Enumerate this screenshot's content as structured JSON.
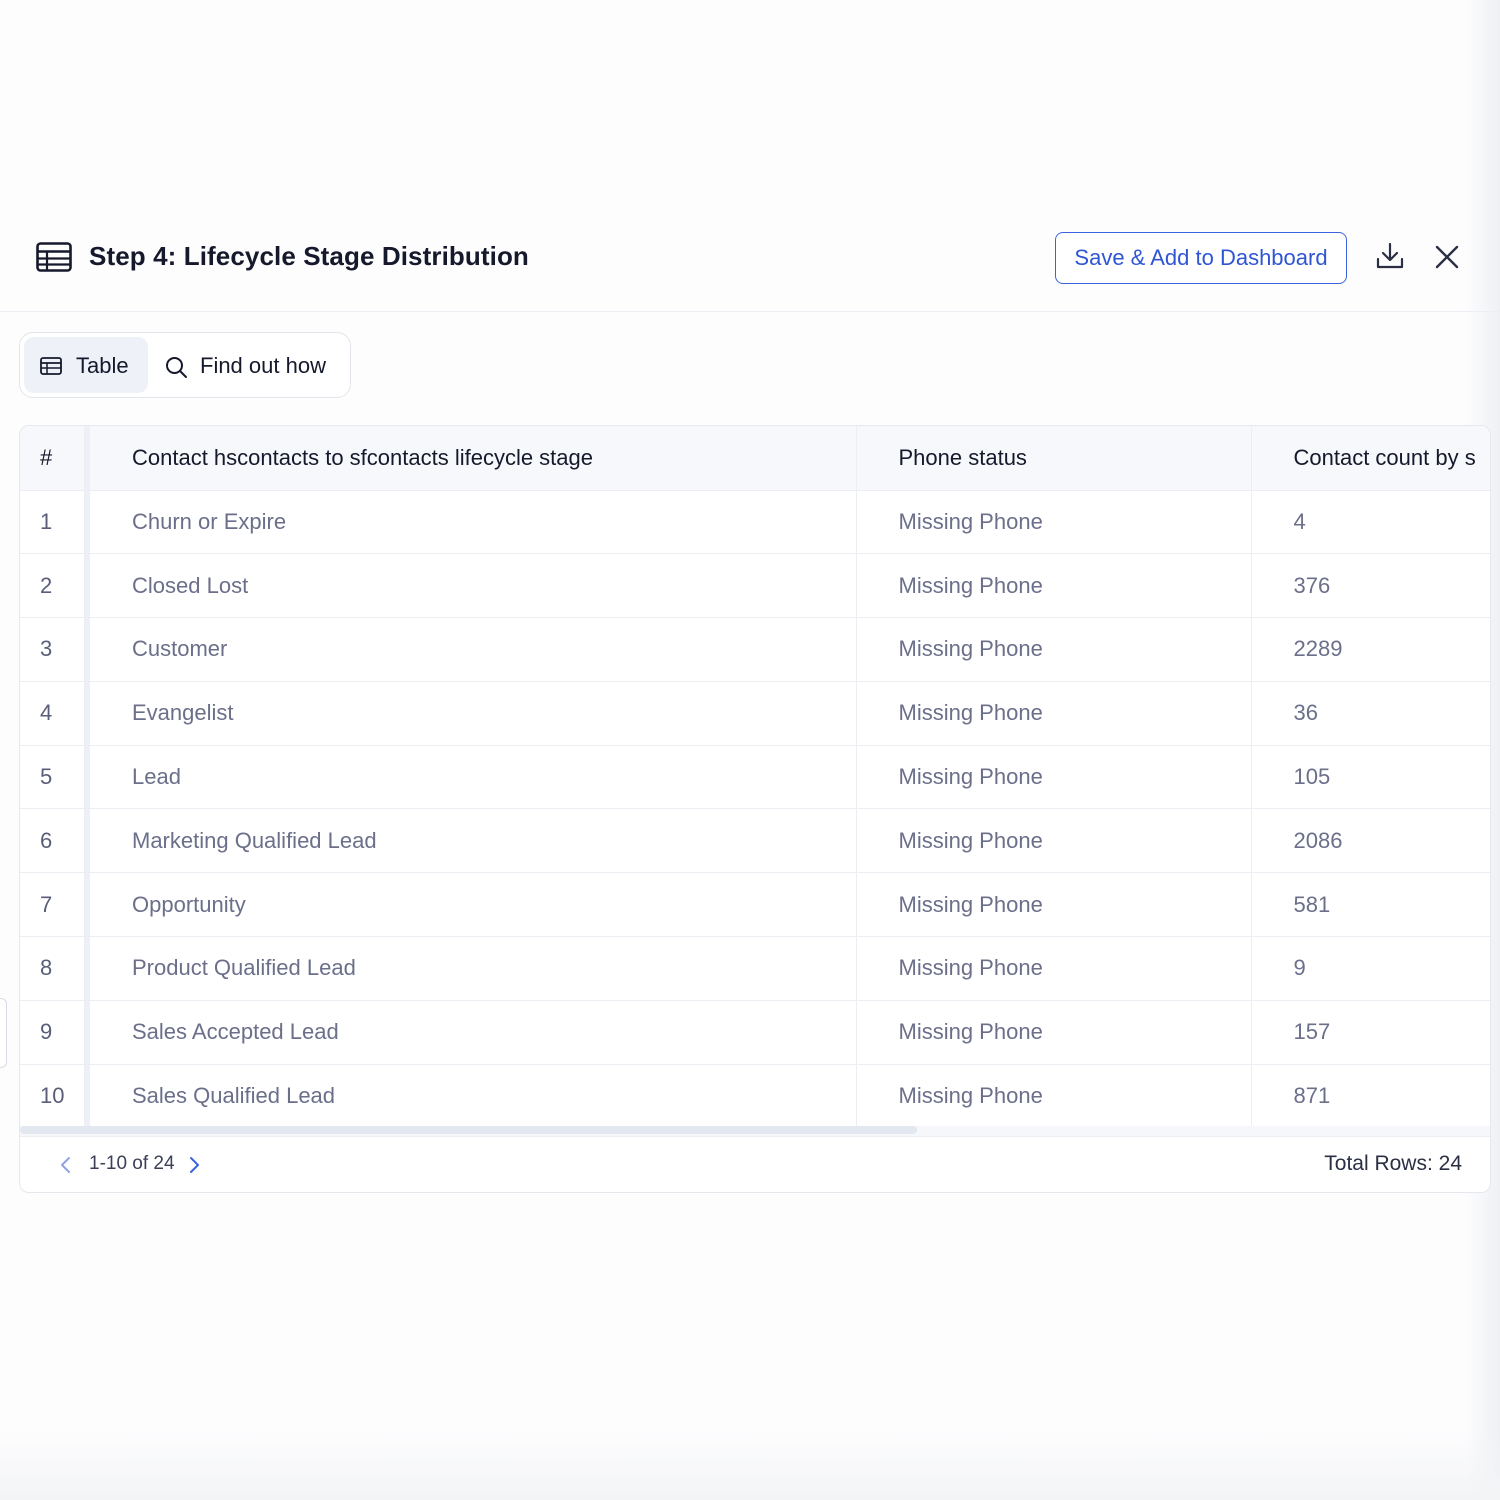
{
  "header": {
    "title": "Step 4: Lifecycle Stage Distribution",
    "save_label": "Save & Add to Dashboard",
    "icons": [
      "table-icon",
      "download-icon",
      "close-icon"
    ]
  },
  "view_toggle": {
    "table_label": "Table",
    "find_label": "Find out how",
    "active": "Table"
  },
  "table": {
    "columns": [
      "#",
      "Contact hscontacts to sfcontacts lifecycle stage",
      "Phone status",
      "Contact count by s"
    ],
    "rows": [
      [
        "1",
        "Churn or Expire",
        "Missing Phone",
        "4"
      ],
      [
        "2",
        "Closed Lost",
        "Missing Phone",
        "376"
      ],
      [
        "3",
        "Customer",
        "Missing Phone",
        "2289"
      ],
      [
        "4",
        "Evangelist",
        "Missing Phone",
        "36"
      ],
      [
        "5",
        "Lead",
        "Missing Phone",
        "105"
      ],
      [
        "6",
        "Marketing Qualified Lead",
        "Missing Phone",
        "2086"
      ],
      [
        "7",
        "Opportunity",
        "Missing Phone",
        "581"
      ],
      [
        "8",
        "Product Qualified Lead",
        "Missing Phone",
        "9"
      ],
      [
        "9",
        "Sales Accepted Lead",
        "Missing Phone",
        "157"
      ],
      [
        "10",
        "Sales Qualified Lead",
        "Missing Phone",
        "871"
      ]
    ],
    "horizontal_scroll_fraction": 0.61
  },
  "pagination": {
    "range": "1-10 of 24",
    "total_rows": "Total Rows: 24"
  },
  "colors": {
    "accent": "#3b63e0",
    "cell_text": "#6b6f8a",
    "header_bg": "#f7f8fb"
  }
}
